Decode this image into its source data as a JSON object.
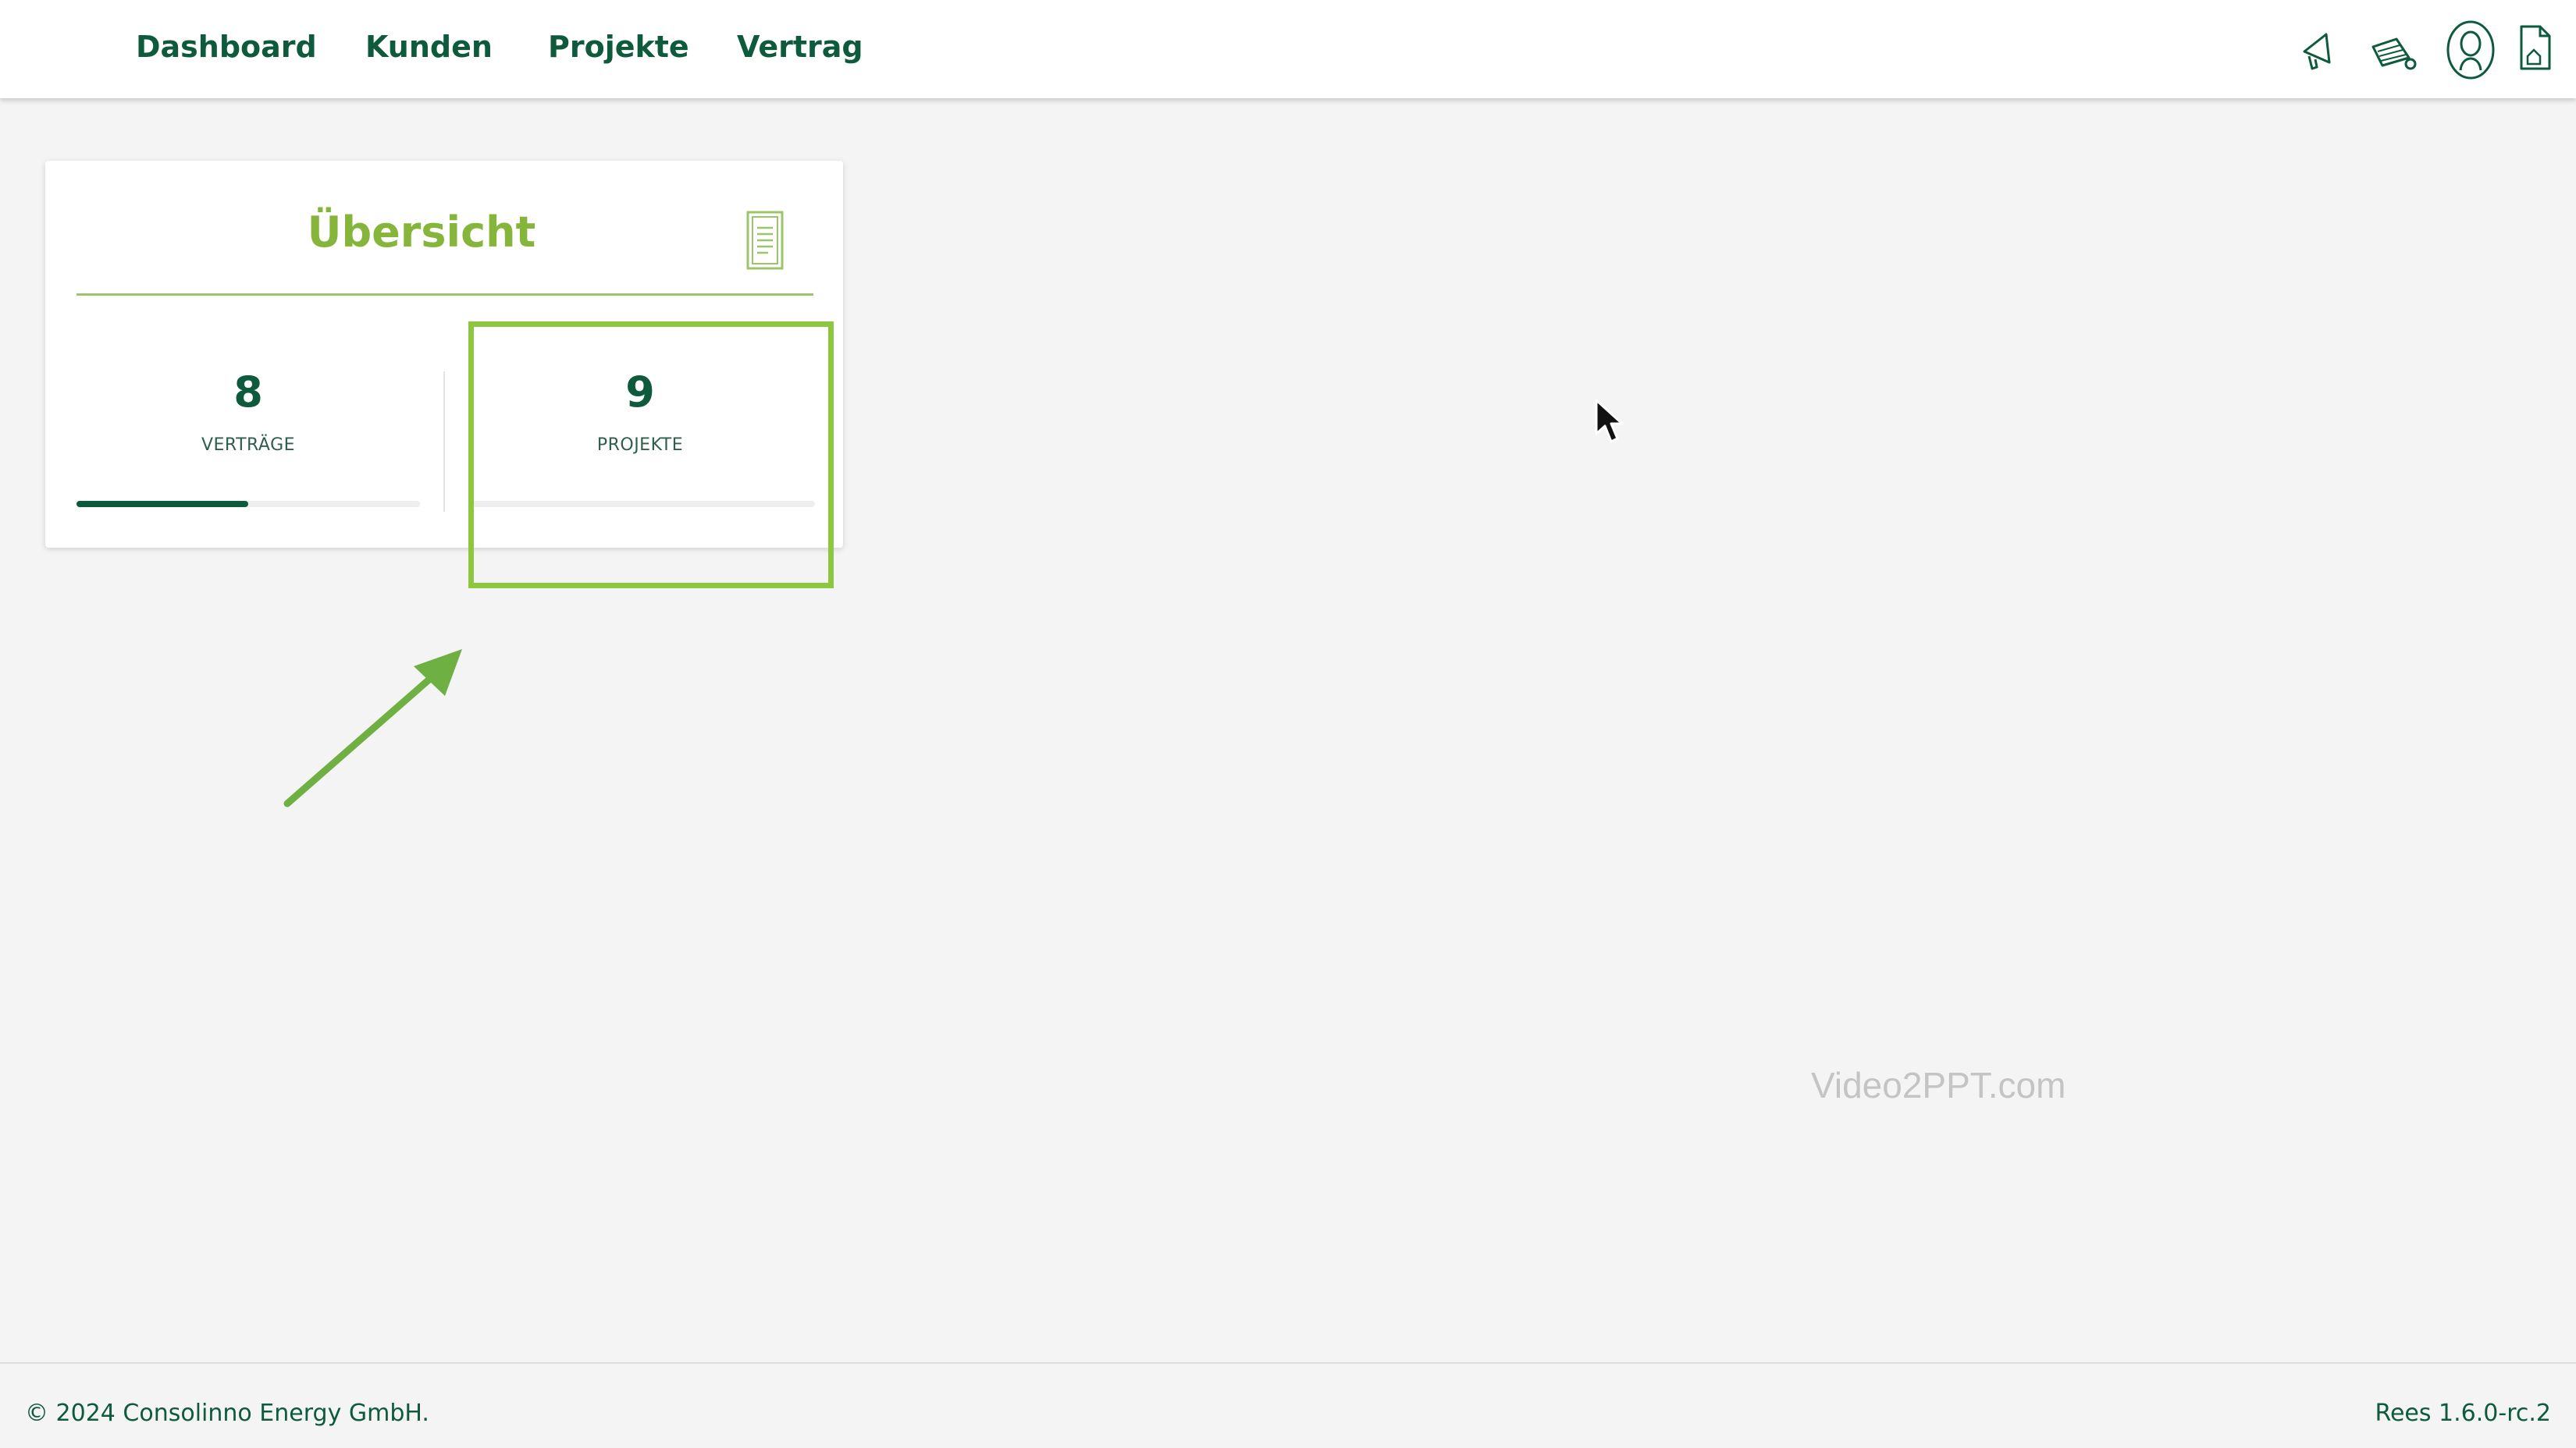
{
  "nav": {
    "items": [
      {
        "label": "Dashboard"
      },
      {
        "label": "Kunden"
      },
      {
        "label": "Projekte"
      },
      {
        "label": "Vertrag"
      }
    ]
  },
  "top_icons": [
    "megaphone-icon",
    "loudspeaker-icon",
    "user-account-icon",
    "document-icon"
  ],
  "overview": {
    "title": "Übersicht",
    "stats": [
      {
        "value": "8",
        "label": "VERTRÄGE",
        "progress": 0.5
      },
      {
        "value": "9",
        "label": "PROJEKTE",
        "progress": 0
      }
    ]
  },
  "watermark": "Video2PPT.com",
  "footer": {
    "copyright": "© 2024 Consolinno Energy GmbH.",
    "version": "Rees 1.6.0-rc.2"
  },
  "colors": {
    "brand_dark_green": "#0d5a3c",
    "accent_green": "#86b53b",
    "highlight_green": "#8dc63f"
  }
}
